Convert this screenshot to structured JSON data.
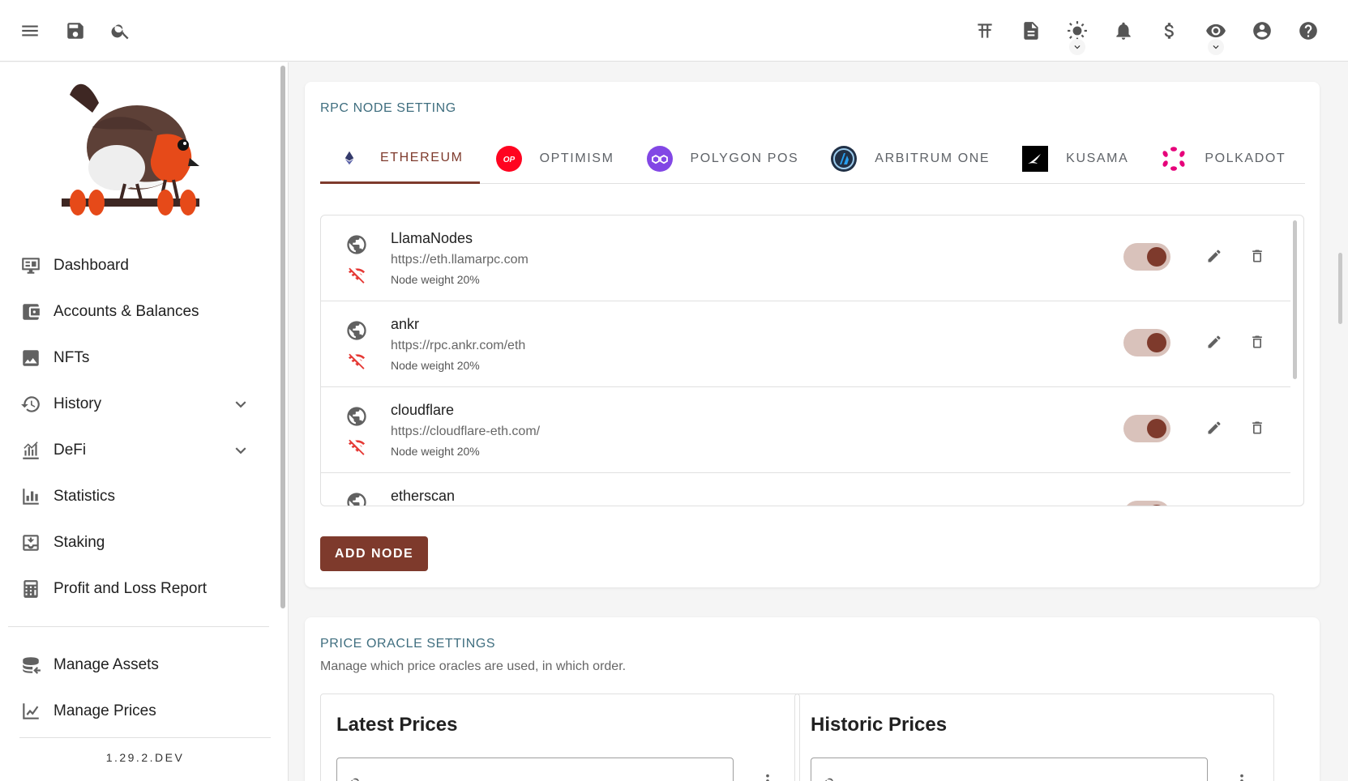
{
  "topbar": {
    "left_icons": [
      "menu-icon",
      "save-icon",
      "search-icon"
    ],
    "right_icons": [
      "node-status-icon",
      "notes-icon",
      "theme-icon",
      "notifications-icon",
      "currency-icon",
      "privacy-icon",
      "account-icon",
      "help-icon"
    ]
  },
  "sidebar": {
    "items": [
      {
        "label": "Dashboard",
        "icon": "dashboard-icon"
      },
      {
        "label": "Accounts & Balances",
        "icon": "wallet-icon"
      },
      {
        "label": "NFTs",
        "icon": "image-icon"
      },
      {
        "label": "History",
        "icon": "history-icon",
        "expandable": true
      },
      {
        "label": "DeFi",
        "icon": "defi-icon",
        "expandable": true
      },
      {
        "label": "Statistics",
        "icon": "bar-chart-icon"
      },
      {
        "label": "Staking",
        "icon": "staking-icon"
      },
      {
        "label": "Profit and Loss Report",
        "icon": "calculator-icon"
      }
    ],
    "bottom_items": [
      {
        "label": "Manage Assets",
        "icon": "assets-icon"
      },
      {
        "label": "Manage Prices",
        "icon": "line-chart-icon"
      }
    ],
    "version": "1.29.2.DEV"
  },
  "rpc": {
    "title": "RPC NODE SETTING",
    "tabs": [
      {
        "label": "ETHEREUM",
        "active": true
      },
      {
        "label": "OPTIMISM",
        "badge": "OP"
      },
      {
        "label": "POLYGON POS"
      },
      {
        "label": "ARBITRUM ONE"
      },
      {
        "label": "KUSAMA"
      },
      {
        "label": "POLKADOT"
      }
    ],
    "nodes": [
      {
        "name": "LlamaNodes",
        "url": "https://eth.llamarpc.com",
        "weight": "Node weight 20%",
        "enabled": true
      },
      {
        "name": "ankr",
        "url": "https://rpc.ankr.com/eth",
        "weight": "Node weight 20%",
        "enabled": true
      },
      {
        "name": "cloudflare",
        "url": "https://cloudflare-eth.com/",
        "weight": "Node weight 20%",
        "enabled": true
      },
      {
        "name": "etherscan",
        "url": "",
        "weight": "",
        "enabled": true
      }
    ],
    "add_button": "ADD NODE"
  },
  "oracle": {
    "title": "PRICE ORACLE SETTINGS",
    "subtitle": "Manage which price oracles are used, in which order.",
    "latest_title": "Latest Prices",
    "historic_title": "Historic Prices"
  },
  "colors": {
    "accent": "#7e3a2c",
    "section_title": "#3f6e7f",
    "toggle_track": "#d9c2bb",
    "disconnected": "#e53935"
  }
}
